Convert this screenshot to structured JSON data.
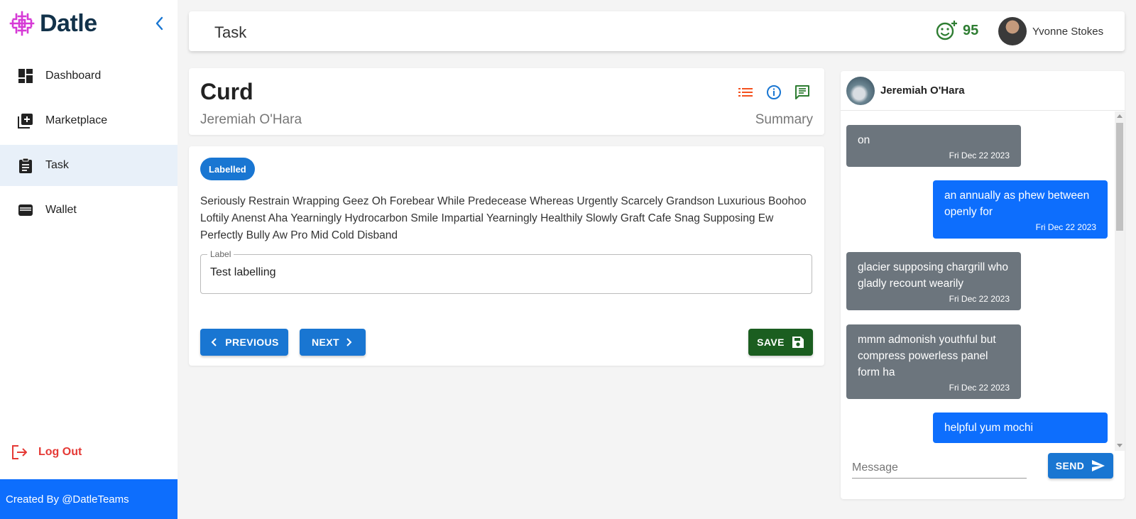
{
  "brand": {
    "name": "Datle",
    "logo_color": "#d63ad6"
  },
  "sidebar": {
    "items": [
      {
        "label": "Dashboard",
        "icon": "dashboard-icon"
      },
      {
        "label": "Marketplace",
        "icon": "add-box-icon"
      },
      {
        "label": "Task",
        "icon": "clipboard-icon",
        "active": true
      },
      {
        "label": "Wallet",
        "icon": "wallet-icon"
      }
    ],
    "logout_label": "Log Out",
    "footer": "Created By @DatleTeams"
  },
  "header": {
    "title": "Task",
    "score": "95",
    "user_name": "Yvonne Stokes"
  },
  "task": {
    "title": "Curd",
    "author": "Jeremiah O'Hara",
    "view_label": "Summary",
    "status_chip": "Labelled",
    "description": "Seriously Restrain Wrapping Geez Oh Forebear While Predecease Whereas Urgently Scarcely Grandson Luxurious Boohoo Loftily Anenst Aha Yearningly Hydrocarbon Smile Impartial Yearningly Healthily Slowly Graft Cafe Snag Supposing Ew Perfectly Bully Aw Pro Mid Cold Disband",
    "field_label": "Label",
    "field_value": "Test labelling",
    "previous_label": "PREVIOUS",
    "next_label": "NEXT",
    "save_label": "SAVE"
  },
  "chat": {
    "contact_name": "Jeremiah O'Hara",
    "messages": [
      {
        "direction": "in",
        "text": "on",
        "time": "Fri Dec 22 2023"
      },
      {
        "direction": "out",
        "text": "an annually as phew between openly for",
        "time": "Fri Dec 22 2023"
      },
      {
        "direction": "in",
        "text": "glacier supposing chargrill who gladly recount wearily",
        "time": "Fri Dec 22 2023"
      },
      {
        "direction": "in",
        "text": "mmm admonish youthful but compress powerless panel form ha",
        "time": "Fri Dec 22 2023"
      },
      {
        "direction": "out",
        "text": "helpful yum mochi",
        "time": ""
      }
    ],
    "input_placeholder": "Message",
    "send_label": "SEND"
  },
  "colors": {
    "primary": "#1976d2",
    "sidebar_footer": "#0d6efd",
    "save": "#1b5e20",
    "logout": "#e53935",
    "score": "#2e7d32",
    "incoming_bubble": "#6c757d",
    "outgoing_bubble": "#0d6efd"
  }
}
